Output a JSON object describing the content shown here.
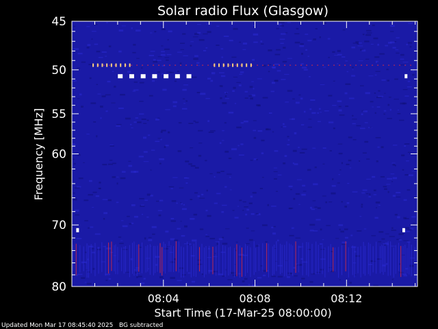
{
  "chart_data": {
    "type": "heatmap",
    "title": "Solar radio Flux (Glasgow)",
    "xlabel": "Start Time (17-Mar-25 08:00:00)",
    "ylabel": "Frequency [MHz]",
    "x_range_minutes": [
      0.0,
      15.1
    ],
    "y_range_mhz": [
      45,
      80
    ],
    "y_scale": "log",
    "x_ticks": [
      {
        "value": 4,
        "label": "08:04"
      },
      {
        "value": 8,
        "label": "08:08"
      },
      {
        "value": 12,
        "label": "08:12"
      }
    ],
    "y_ticks_major": [
      {
        "value": 45,
        "label": "45"
      },
      {
        "value": 50,
        "label": "50"
      },
      {
        "value": 55,
        "label": "55"
      },
      {
        "value": 60,
        "label": "60"
      },
      {
        "value": 70,
        "label": "70"
      },
      {
        "value": 80,
        "label": "80"
      }
    ],
    "y_ticks_minor": [
      46,
      47,
      48,
      49,
      51,
      52,
      53,
      54,
      56,
      57,
      58,
      59,
      62,
      64,
      66,
      68,
      72,
      74,
      76,
      78
    ],
    "colors": {
      "background": "#000000",
      "spectrogram": "#1a1aa6",
      "noise_dark": "#10107a",
      "noise_light": "#2a2ad0",
      "interference": "#ff3030",
      "burst": "#ffd080",
      "saturated": "#ffffff",
      "axis": "#ffffff"
    },
    "features": [
      {
        "kind": "white-markers",
        "frequency_mhz": 50.7,
        "times_min": [
          2.1,
          2.6,
          3.1,
          3.6,
          4.1,
          4.6,
          5.1,
          14.6
        ]
      },
      {
        "kind": "white-markers",
        "frequency_mhz": 70.8,
        "times_min": [
          0.25,
          14.5
        ]
      },
      {
        "kind": "interference-line",
        "frequency_mhz": 49.5,
        "time_range_min": [
          0.9,
          14.9
        ]
      },
      {
        "kind": "rfi-band",
        "frequency_range_mhz": [
          72.5,
          78.5
        ],
        "time_range_min": [
          0.0,
          15.1
        ]
      }
    ]
  },
  "footer": {
    "updated": "Updated Mon Mar 17 08:45:40 2025",
    "note": "BG subtracted"
  }
}
